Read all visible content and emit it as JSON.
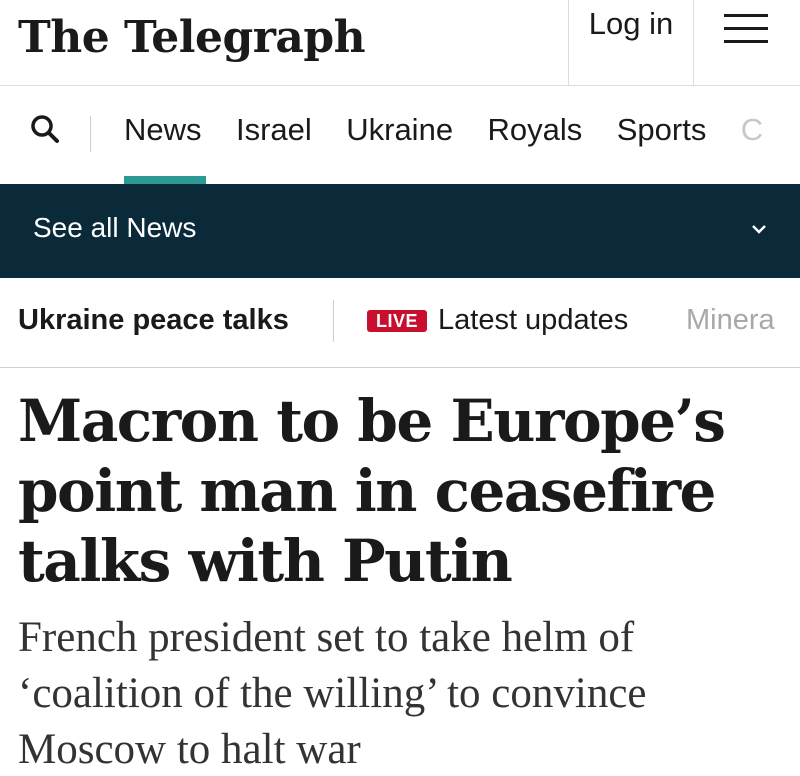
{
  "header": {
    "logo": "The Telegraph",
    "login_label": "Log in"
  },
  "nav": {
    "items": [
      "News",
      "Israel",
      "Ukraine",
      "Royals",
      "Sports",
      "C"
    ],
    "active": "News"
  },
  "section_bar": {
    "label": "See all News"
  },
  "subnav": {
    "topic": "Ukraine peace talks",
    "live_badge": "LIVE",
    "latest": "Latest updates",
    "next": "Minera"
  },
  "article": {
    "headline": "Macron to be Europe’s point man in ceasefire talks with Putin",
    "standfirst": "French president set to take helm of ‘coalition of the willing’ to convince Moscow to halt war"
  },
  "colors": {
    "accent_teal": "#2b9a92",
    "section_bar_bg": "#0a2a3a",
    "live_red": "#c8102e"
  },
  "icons": {
    "search": "search-icon",
    "menu": "hamburger-menu-icon",
    "chevron": "chevron-down-icon"
  }
}
